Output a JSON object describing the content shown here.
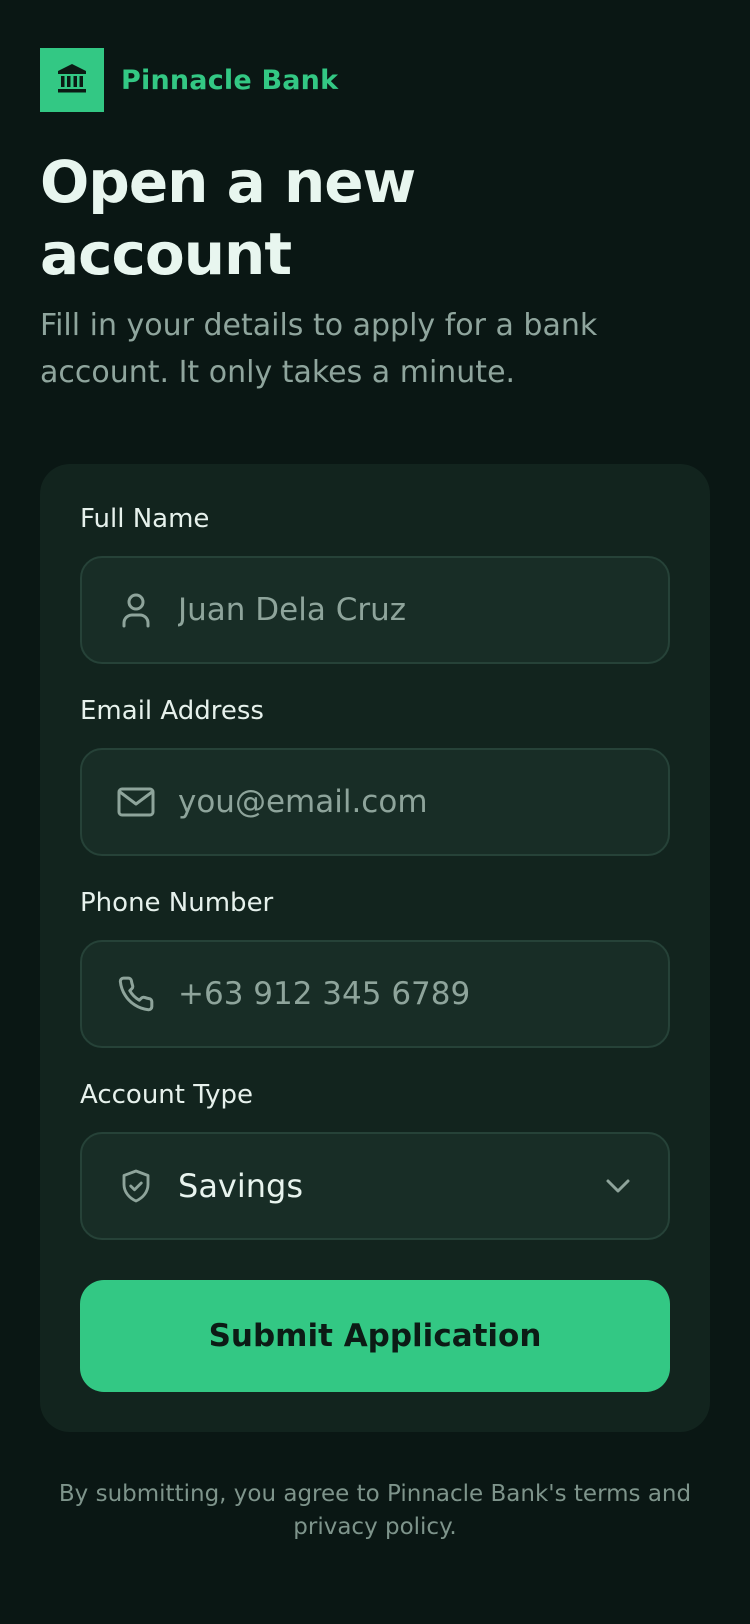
{
  "brand": {
    "name": "Pinnacle Bank",
    "accent_color": "#33c884",
    "logo_icon": "bank-icon"
  },
  "header": {
    "title": "Open a new account",
    "subtitle": "Fill in your details to apply for a bank account. It only takes a minute."
  },
  "form": {
    "full_name": {
      "label": "Full Name",
      "placeholder": "Juan Dela Cruz",
      "value": "",
      "icon": "user-icon"
    },
    "email": {
      "label": "Email Address",
      "placeholder": "you@email.com",
      "value": "",
      "icon": "mail-icon"
    },
    "phone": {
      "label": "Phone Number",
      "placeholder": "+63 912 345 6789",
      "value": "",
      "icon": "phone-icon"
    },
    "account_type": {
      "label": "Account Type",
      "selected": "Savings",
      "icon": "shield-check-icon"
    },
    "submit_label": "Submit Application"
  },
  "footer": {
    "note": "By submitting, you agree to Pinnacle Bank's terms and privacy policy."
  }
}
